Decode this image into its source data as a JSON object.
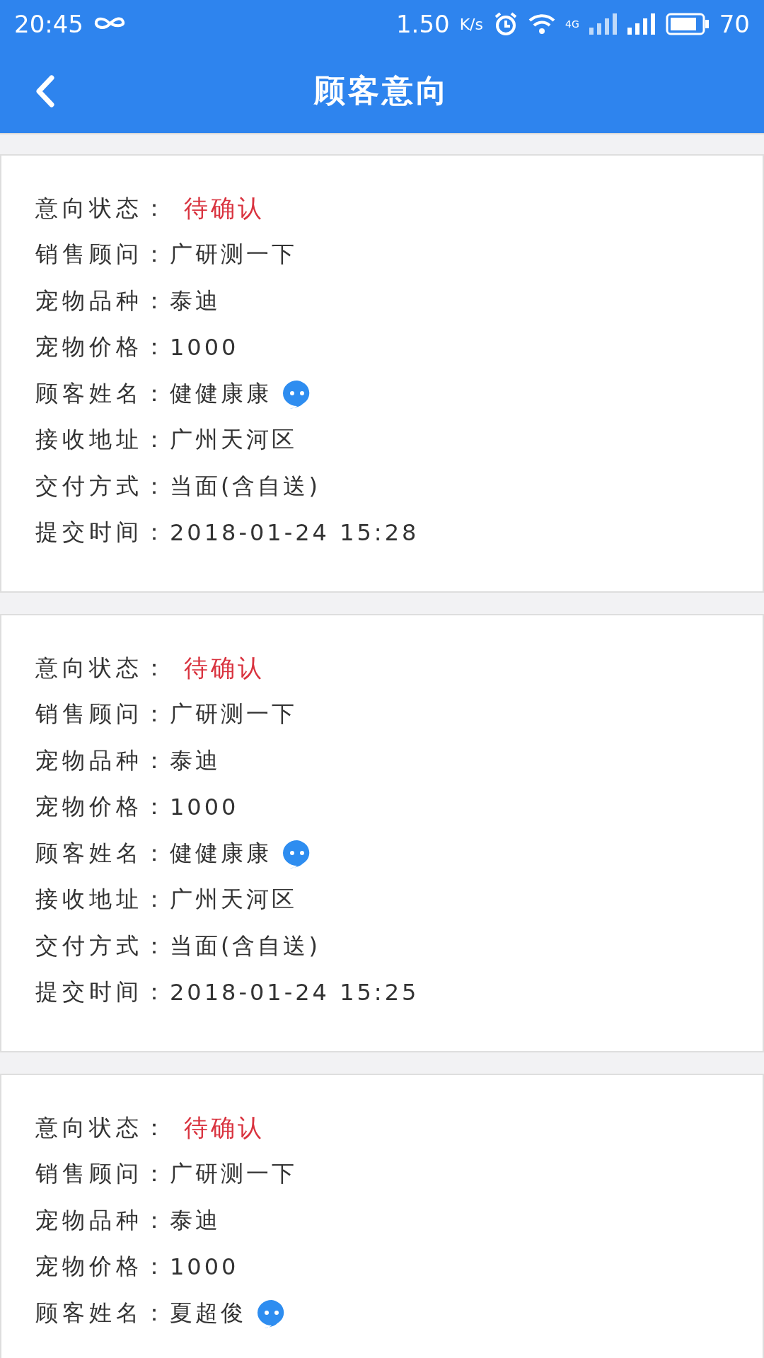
{
  "status_bar": {
    "time": "20:45",
    "net_speed": "1.50",
    "speed_unit": "K/s",
    "network_type": "4G",
    "battery": "70"
  },
  "header": {
    "title": "顾客意向"
  },
  "cards": [
    {
      "fields": [
        {
          "label": "意向状态：",
          "value": "待确认",
          "kind": "status"
        },
        {
          "label": "销售顾问：",
          "value": "广研测一下",
          "kind": "text"
        },
        {
          "label": "宠物品种：",
          "value": "泰迪",
          "kind": "text"
        },
        {
          "label": "宠物价格：",
          "value": "1000",
          "kind": "text"
        },
        {
          "label": "顾客姓名：",
          "value": "健健康康",
          "kind": "contact"
        },
        {
          "label": "接收地址：",
          "value": "广州天河区",
          "kind": "text"
        },
        {
          "label": "交付方式：",
          "value": "当面(含自送)",
          "kind": "text"
        },
        {
          "label": "提交时间：",
          "value": "2018-01-24 15:28",
          "kind": "text"
        }
      ]
    },
    {
      "fields": [
        {
          "label": "意向状态：",
          "value": "待确认",
          "kind": "status"
        },
        {
          "label": "销售顾问：",
          "value": "广研测一下",
          "kind": "text"
        },
        {
          "label": "宠物品种：",
          "value": "泰迪",
          "kind": "text"
        },
        {
          "label": "宠物价格：",
          "value": "1000",
          "kind": "text"
        },
        {
          "label": "顾客姓名：",
          "value": "健健康康",
          "kind": "contact"
        },
        {
          "label": "接收地址：",
          "value": "广州天河区",
          "kind": "text"
        },
        {
          "label": "交付方式：",
          "value": "当面(含自送)",
          "kind": "text"
        },
        {
          "label": "提交时间：",
          "value": "2018-01-24 15:25",
          "kind": "text"
        }
      ]
    },
    {
      "fields": [
        {
          "label": "意向状态：",
          "value": "待确认",
          "kind": "status"
        },
        {
          "label": "销售顾问：",
          "value": "广研测一下",
          "kind": "text"
        },
        {
          "label": "宠物品种：",
          "value": "泰迪",
          "kind": "text"
        },
        {
          "label": "宠物价格：",
          "value": "1000",
          "kind": "text"
        },
        {
          "label": "顾客姓名：",
          "value": "夏超俊",
          "kind": "contact"
        }
      ]
    }
  ]
}
